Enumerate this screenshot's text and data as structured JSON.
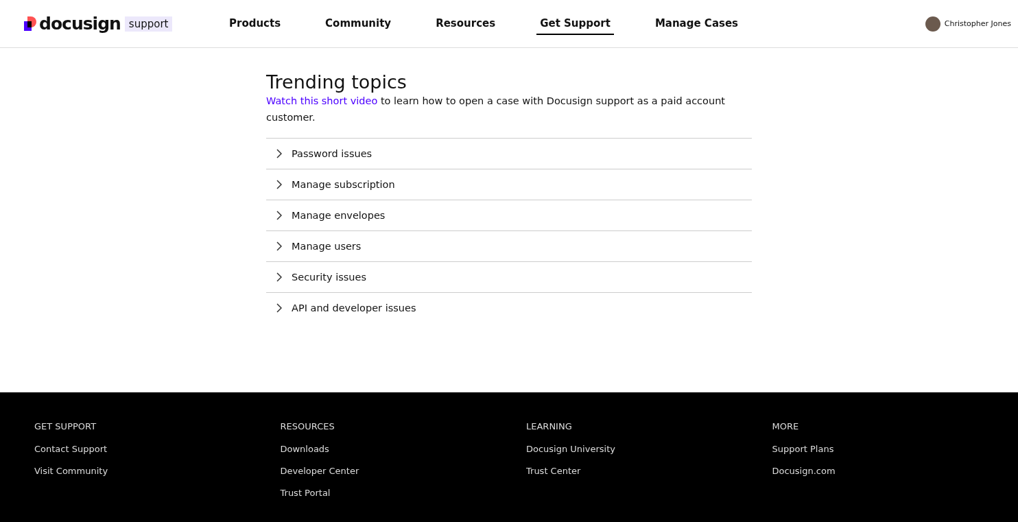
{
  "header": {
    "logo": "docusign",
    "logo_badge": "support",
    "nav": [
      {
        "label": "Products",
        "selected": false
      },
      {
        "label": "Community",
        "selected": false
      },
      {
        "label": "Resources",
        "selected": false
      },
      {
        "label": "Get Support",
        "selected": true
      },
      {
        "label": "Manage Cases",
        "selected": false
      }
    ],
    "user": {
      "name": "Christopher Jones"
    }
  },
  "trending": {
    "title": "Trending topics",
    "link": "Watch this short video",
    "text": " to learn how to open a case with Docusign support as a paid account customer.",
    "topics": [
      {
        "label": "Password issues",
        "expanded": false
      },
      {
        "label": "Manage subscription",
        "expanded": false
      },
      {
        "label": "Manage envelopes",
        "expanded": false
      },
      {
        "label": "Manage users",
        "expanded": false
      },
      {
        "label": "Security issues",
        "expanded": false
      },
      {
        "label": "API and developer issues",
        "expanded": false
      }
    ]
  },
  "footer": {
    "columns": [
      {
        "heading": "GET SUPPORT",
        "links": [
          "Contact Support",
          "Visit Community"
        ]
      },
      {
        "heading": "RESOURCES",
        "links": [
          "Downloads",
          "Developer Center",
          "Trust Portal"
        ]
      },
      {
        "heading": "LEARNING",
        "links": [
          "Docusign University",
          "Trust Center"
        ]
      },
      {
        "heading": "MORE",
        "links": [
          "Support Plans",
          "Docusign.com"
        ]
      }
    ]
  }
}
